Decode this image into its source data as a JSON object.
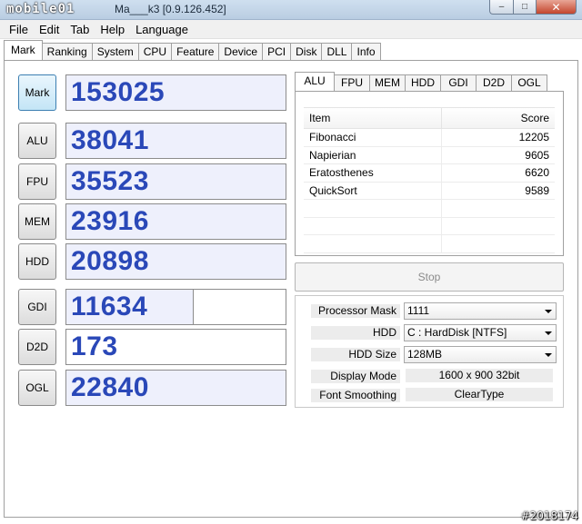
{
  "window": {
    "logo": "mobile01",
    "title": "Ma___k3 [0.9.126.452]",
    "controls": {
      "minimize": "–",
      "maximize": "□",
      "close": "✕"
    }
  },
  "menu": [
    "File",
    "Edit",
    "Tab",
    "Help",
    "Language"
  ],
  "main_tabs": [
    "Mark",
    "Ranking",
    "System",
    "CPU",
    "Feature",
    "Device",
    "PCI",
    "Disk",
    "DLL",
    "Info"
  ],
  "scores": [
    {
      "label": "Mark",
      "value": "153025",
      "fill": 1.0
    },
    {
      "label": "ALU",
      "value": "38041",
      "fill": 1.0
    },
    {
      "label": "FPU",
      "value": "35523",
      "fill": 1.0
    },
    {
      "label": "MEM",
      "value": "23916",
      "fill": 1.0
    },
    {
      "label": "HDD",
      "value": "20898",
      "fill": 1.0
    },
    {
      "label": "GDI",
      "value": "11634",
      "fill": 0.58
    },
    {
      "label": "D2D",
      "value": "173",
      "fill": 0.0
    },
    {
      "label": "OGL",
      "value": "22840",
      "fill": 1.0
    }
  ],
  "sub_tabs": [
    "ALU",
    "FPU",
    "MEM",
    "HDD",
    "GDI",
    "D2D",
    "OGL"
  ],
  "table": {
    "headers": {
      "item": "Item",
      "score": "Score"
    },
    "rows": [
      {
        "item": "Fibonacci",
        "score": "12205"
      },
      {
        "item": "Napierian",
        "score": "9605"
      },
      {
        "item": "Eratosthenes",
        "score": "6620"
      },
      {
        "item": "QuickSort",
        "score": "9589"
      }
    ]
  },
  "stop_label": "Stop",
  "settings": {
    "processor_mask": {
      "label": "Processor Mask",
      "value": "1111"
    },
    "hdd": {
      "label": "HDD",
      "value": "C : HardDisk [NTFS]"
    },
    "hdd_size": {
      "label": "HDD Size",
      "value": "128MB"
    },
    "display_mode": {
      "label": "Display Mode",
      "value": "1600 x 900 32bit"
    },
    "font_smoothing": {
      "label": "Font Smoothing",
      "value": "ClearType"
    }
  },
  "watermark": "#2018174"
}
